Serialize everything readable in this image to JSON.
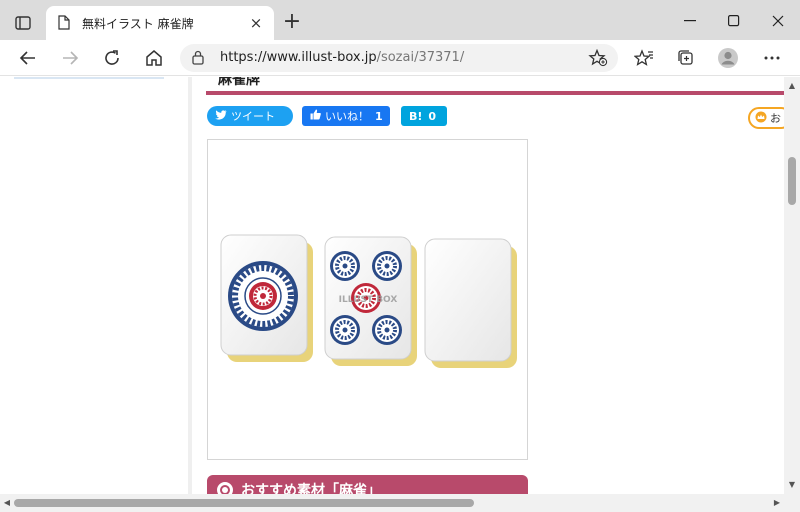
{
  "browser": {
    "tab_title": "無料イラスト 麻雀牌",
    "close_tab_glyph": "×",
    "new_tab_glyph": "+",
    "url_host": "https://www.illust-box.jp",
    "url_path": "/sozai/37371/"
  },
  "page": {
    "heading": "麻雀牌",
    "share": {
      "tweet_label": "ツイート",
      "like_label": "いいね！",
      "like_count": "1",
      "hatena_label": "B!",
      "hatena_count": "0"
    },
    "favorite_label": "お",
    "image_watermark": "ILLUST BOX",
    "recommend_title": "おすすめ素材「麻雀」"
  },
  "colors": {
    "accent": "#b84a6b",
    "twitter": "#1da1f2",
    "facebook": "#1877f2",
    "hatena": "#00a4de",
    "tile_navy": "#2a4a86",
    "tile_red": "#c0283a",
    "tile_back": "#e8d37a"
  },
  "icons": [
    "tab-actions-icon",
    "page-icon",
    "minimize-icon",
    "maximize-icon",
    "close-icon",
    "back-arrow-icon",
    "forward-arrow-icon",
    "refresh-icon",
    "home-icon",
    "lock-icon",
    "star-add-icon",
    "favorites-icon",
    "collections-icon",
    "profile-icon",
    "more-icon",
    "twitter-bird-icon",
    "thumbs-up-icon",
    "crown-icon"
  ]
}
